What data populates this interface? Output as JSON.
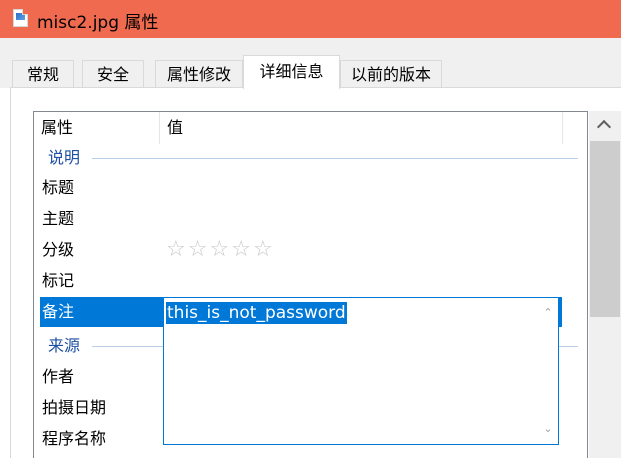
{
  "window": {
    "title": "misc2.jpg 属性",
    "file_icon": "jpg-image-file-icon"
  },
  "tabs": [
    {
      "label": "常规",
      "active": false
    },
    {
      "label": "安全",
      "active": false
    },
    {
      "label": "属性修改",
      "active": false
    },
    {
      "label": "详细信息",
      "active": true
    },
    {
      "label": "以前的版本",
      "active": false
    }
  ],
  "details": {
    "columns": {
      "property": "属性",
      "value": "值"
    },
    "groups": [
      {
        "label": "说明"
      },
      {
        "label": "来源"
      }
    ],
    "description_rows": [
      {
        "name": "标题",
        "value": ""
      },
      {
        "name": "主题",
        "value": ""
      },
      {
        "name": "分级",
        "value": "",
        "rating": 0,
        "rating_max": 5
      },
      {
        "name": "标记",
        "value": ""
      },
      {
        "name": "备注",
        "value": "this_is_not_password",
        "selected": true,
        "editing": true
      }
    ],
    "origin_rows": [
      {
        "name": "作者",
        "value": ""
      },
      {
        "name": "拍摄日期",
        "value": ""
      },
      {
        "name": "程序名称",
        "value": ""
      }
    ]
  },
  "icons": {
    "rating": "empty-star-icon",
    "scroll_up": "chevron-up-icon",
    "scroll_down": "chevron-down-icon"
  },
  "colors": {
    "titlebar": "#f06a4f",
    "selection": "#0078d7",
    "group_header": "#1e4fa3"
  }
}
